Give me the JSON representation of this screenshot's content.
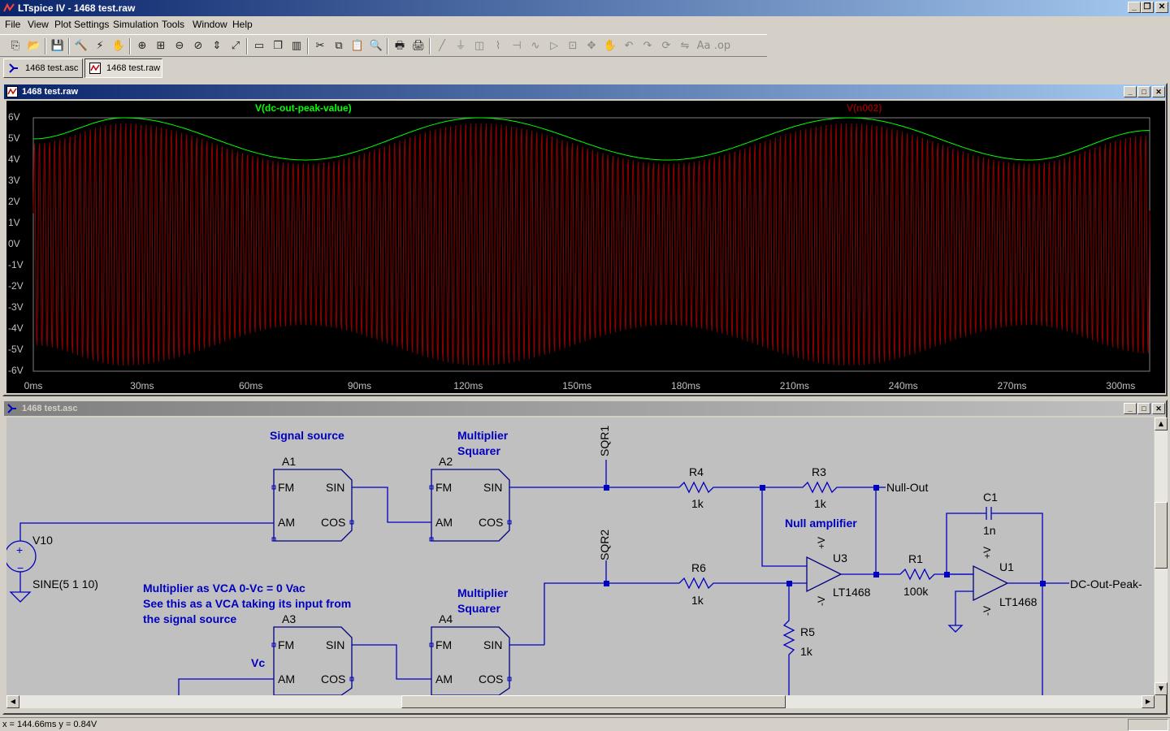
{
  "window": {
    "title": "LTspice IV - 1468 test.raw"
  },
  "menu": [
    "File",
    "View",
    "Plot Settings",
    "Simulation",
    "Tools",
    "Window",
    "Help"
  ],
  "toolbar_icons": [
    "new-schematic-icon",
    "open-icon",
    "save-icon",
    "control-panel-icon",
    "run-icon",
    "pan-icon",
    "zoom-in-icon",
    "zoom-area-icon",
    "zoom-out-icon",
    "zoom-cancel-icon",
    "autorange-icon",
    "zoom-extent-icon",
    "tile-horizontal-icon",
    "cascade-icon",
    "tile-vertical-icon",
    "cut-icon",
    "copy-icon",
    "paste-icon",
    "find-icon",
    "print-setup-icon",
    "print-icon",
    "wire-icon",
    "ground-icon",
    "label-net-icon",
    "resistor-icon",
    "capacitor-icon",
    "inductor-icon",
    "diode-icon",
    "component-icon",
    "move-icon",
    "drag-icon",
    "undo-icon",
    "redo-icon",
    "rotate-icon",
    "mirror-icon",
    "text-icon",
    "spice-directive-icon"
  ],
  "tabs": [
    {
      "label": "1468 test.asc"
    },
    {
      "label": "1468 test.raw"
    }
  ],
  "plot_window": {
    "title": "1468 test.raw",
    "traces": [
      {
        "name": "V(dc-out-peak-value)",
        "color": "#00ff00"
      },
      {
        "name": "V(n002)",
        "color": "#8b0000"
      }
    ],
    "y_ticks": [
      "6V",
      "5V",
      "4V",
      "3V",
      "2V",
      "1V",
      "0V",
      "-1V",
      "-2V",
      "-3V",
      "-4V",
      "-5V",
      "-6V"
    ],
    "x_ticks": [
      "0ms",
      "30ms",
      "60ms",
      "90ms",
      "120ms",
      "150ms",
      "180ms",
      "210ms",
      "240ms",
      "270ms",
      "300ms"
    ]
  },
  "chart_data": {
    "type": "line",
    "xlabel": "",
    "ylabel": "",
    "xlim": [
      0,
      308
    ],
    "ylim": [
      -6,
      6
    ],
    "x_unit": "ms",
    "y_unit": "V",
    "series": [
      {
        "name": "V(dc-out-peak-value)",
        "color": "#00ff00",
        "description_points": {
          "x": [
            0,
            25,
            75,
            123,
            175,
            225,
            275,
            308
          ],
          "y": [
            5.0,
            6.0,
            4.0,
            6.0,
            4.0,
            6.0,
            4.0,
            5.4
          ]
        }
      },
      {
        "name": "V(n002)",
        "color": "#8b0000",
        "carrier_cycles": 220,
        "envelope": {
          "x": [
            0,
            25,
            75,
            123,
            175,
            225,
            275,
            308
          ],
          "y": [
            5.0,
            6.0,
            4.0,
            6.0,
            4.0,
            6.0,
            4.0,
            5.4
          ]
        }
      }
    ]
  },
  "schematic_window": {
    "title": "1468 test.asc",
    "comments": {
      "signal_source": "Signal source",
      "mult1_line1": "Multiplier",
      "mult1_line2": "Squarer",
      "mult2_line1": "Multiplier",
      "mult2_line2": "Squarer",
      "vca_line1": "Multiplier as VCA  0-Vc = 0 Vac",
      "vca_line2": "See this as a VCA taking its input from",
      "vca_line3": "the signal source",
      "null_amp": "Null amplifier"
    },
    "labels": {
      "a1": "A1",
      "a2": "A2",
      "a3": "A3",
      "a4": "A4",
      "fm": "FM",
      "sin": "SIN",
      "am": "AM",
      "cos": "COS",
      "v10": "V10",
      "v10_value": "SINE(5 1 10)",
      "sqr1": "SQR1",
      "sqr2": "SQR2",
      "r4": "R4",
      "r4_value": "1k",
      "r3": "R3",
      "r3_value": "1k",
      "r6": "R6",
      "r6_value": "1k",
      "r5": "R5",
      "r5_value": "1k",
      "r1": "R1",
      "r1_value": "100k",
      "c1": "C1",
      "c1_value": "1n",
      "u3": "U3",
      "u3_part": "LT1468",
      "u1": "U1",
      "u1_part": "LT1468",
      "null_out": "Null-Out",
      "dc_out": "DC-Out-Peak-",
      "vc": "Vc",
      "plus_v": "+V",
      "minus_v": "-V"
    }
  },
  "status": {
    "text": "x = 144.66ms    y = 0.84V"
  }
}
